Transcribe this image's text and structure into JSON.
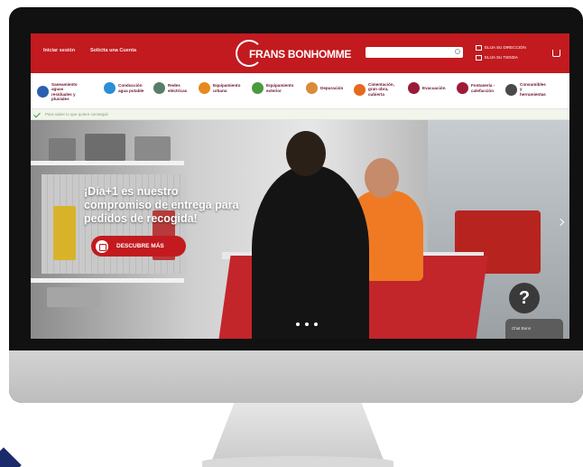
{
  "header": {
    "login_link": "Iniciar sesión",
    "request_account_link": "Solicita una Cuenta",
    "brand": "FRANS BONHOMME",
    "search_placeholder": "",
    "delivery_label": "ELIJA SU DIRECCIÓN",
    "store_label": "ELIJA SU TIENDA",
    "colors": {
      "primary": "#c21a1f",
      "text_on_primary": "#ffffff"
    }
  },
  "categories": [
    {
      "label": "Saneamiento aguas residuales y pluviales",
      "icon": "pipe-icon",
      "color": "#2c5fb0"
    },
    {
      "label": "Conducción agua potable",
      "icon": "water-drop-icon",
      "color": "#2a8fd6"
    },
    {
      "label": "Redes eléctricas",
      "icon": "electric-icon",
      "color": "#5a7d6b"
    },
    {
      "label": "Equipamiento urbano",
      "icon": "urban-icon",
      "color": "#e58a1f"
    },
    {
      "label": "Equipamiento exterior",
      "icon": "outdoor-icon",
      "color": "#4a9a3e"
    },
    {
      "label": "Depuración",
      "icon": "filter-icon",
      "color": "#d98b3a"
    },
    {
      "label": "Cimentación, gran obra, cubierta",
      "icon": "foundation-icon",
      "color": "#e36a1e"
    },
    {
      "label": "Evacuación",
      "icon": "drain-icon",
      "color": "#9a1a3a"
    },
    {
      "label": "Fontanería - calefacción",
      "icon": "heating-icon",
      "color": "#9e1b36"
    },
    {
      "label": "Consumibles y herramientas",
      "icon": "tools-icon",
      "color": "#4a4a4a"
    }
  ],
  "infobar": {
    "text": "Para saber lo que quiere conseguir"
  },
  "hero": {
    "title": "¡Día+1 es nuestro compromiso de entrega para pedidos de recogida!",
    "cta_label": "DESCUBRE MÁS",
    "slides_count": 3
  },
  "chat": {
    "help_glyph": "?",
    "tab_label": "Chat Bonn"
  }
}
